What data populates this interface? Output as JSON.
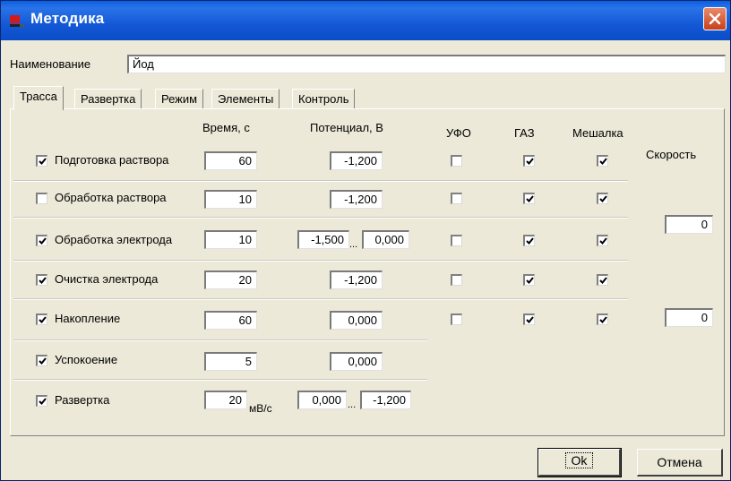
{
  "window": {
    "title": "Методика"
  },
  "form": {
    "name_label": "Наименование",
    "name_value": "Йод"
  },
  "tabs": [
    "Трасса",
    "Развертка",
    "Режим",
    "Элементы",
    "Контроль"
  ],
  "headers": {
    "time": "Время, с",
    "potential": "Потенциал, В",
    "ufo": "УФО",
    "gas": "ГАЗ",
    "stirrer": "Мешалка",
    "speed": "Скорость"
  },
  "rows": [
    {
      "label": "Подготовка раствора",
      "checked": true,
      "time": "60",
      "potential": "-1,200",
      "ufo": false,
      "gas": true,
      "stirrer": true
    },
    {
      "label": "Обработка раствора",
      "checked": false,
      "time": "10",
      "potential": "-1,200",
      "ufo": false,
      "gas": true,
      "stirrer": true
    },
    {
      "label": "Обработка электрода",
      "checked": true,
      "time": "10",
      "potential_from": "-1,500",
      "potential_to": "0,000",
      "ufo": false,
      "gas": true,
      "stirrer": true
    },
    {
      "label": "Очистка электрода",
      "checked": true,
      "time": "20",
      "potential": "-1,200",
      "ufo": false,
      "gas": true,
      "stirrer": true
    },
    {
      "label": "Накопление",
      "checked": true,
      "time": "60",
      "potential": "0,000",
      "ufo": false,
      "gas": true,
      "stirrer": true
    },
    {
      "label": "Успокоение",
      "checked": true,
      "time": "5",
      "potential": "0,000"
    },
    {
      "label": "Развертка",
      "checked": true,
      "time": "20",
      "time_unit": "мВ/с",
      "potential_from": "0,000",
      "potential_to": "-1,200"
    }
  ],
  "range_separator": "...",
  "speed": {
    "value1": "0",
    "value2": "0"
  },
  "buttons": {
    "ok": "Ok",
    "cancel": "Отмена"
  },
  "colors": {
    "titlebar": "#0b4cc6",
    "window_bg": "#ece9d8",
    "close": "#c6401c"
  },
  "icons": {
    "app": "app-icon",
    "close": "close-icon",
    "check": "checkmark-icon"
  }
}
